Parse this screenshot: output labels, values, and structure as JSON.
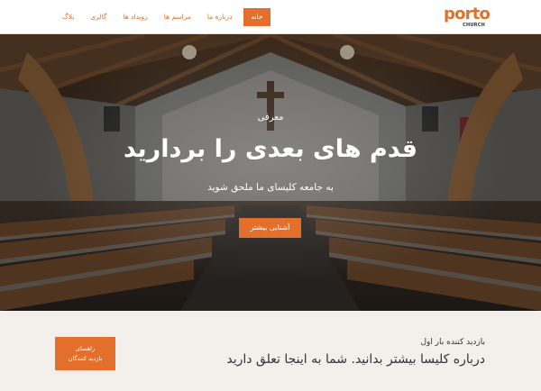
{
  "header": {
    "logo": {
      "word": "porto",
      "sub": "CHURCH"
    },
    "nav": [
      {
        "label": "خانه",
        "active": true
      },
      {
        "label": "درباره ما",
        "active": false
      },
      {
        "label": "مراسم ها",
        "active": false
      },
      {
        "label": "رویداد ها",
        "active": false
      },
      {
        "label": "گالری",
        "active": false
      },
      {
        "label": "بلاگ",
        "active": false
      }
    ]
  },
  "hero": {
    "eyebrow": "معرفی",
    "title": "قدم های بعدی را بردارید",
    "subtitle": "به جامعه کلیسای ما ملحق شوید",
    "button": "آشنایی بیشتر"
  },
  "band": {
    "label": "بازدید کننده بار اول",
    "text": "درباره کلیسا بیشتر بدانید. شما به اینجا تعلق دارید",
    "button_line1": "راهنمای",
    "button_line2": "بازدید کنندگان"
  },
  "colors": {
    "accent": "#e36f2a",
    "band_bg": "#f3f0ec"
  }
}
